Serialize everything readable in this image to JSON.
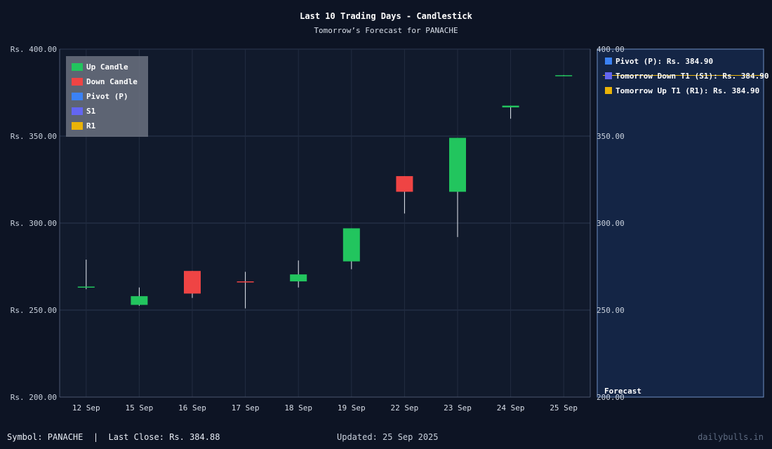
{
  "chart_data": {
    "type": "candlestick",
    "title": "Last 10 Trading Days - Candlestick",
    "subtitle": "Tomorrow’s Forecast for PANACHE",
    "categories": [
      "12 Sep",
      "15 Sep",
      "16 Sep",
      "17 Sep",
      "18 Sep",
      "19 Sep",
      "22 Sep",
      "23 Sep",
      "24 Sep",
      "25 Sep"
    ],
    "ohlc": [
      {
        "x": "12 Sep",
        "open": 263.0,
        "high": 279.0,
        "low": 262.0,
        "close": 263.5
      },
      {
        "x": "15 Sep",
        "open": 253.0,
        "high": 263.0,
        "low": 252.5,
        "close": 258.0
      },
      {
        "x": "16 Sep",
        "open": 272.5,
        "high": 272.5,
        "low": 257.0,
        "close": 259.5
      },
      {
        "x": "17 Sep",
        "open": 266.5,
        "high": 272.0,
        "low": 251.0,
        "close": 266.0
      },
      {
        "x": "18 Sep",
        "open": 266.5,
        "high": 278.5,
        "low": 263.0,
        "close": 270.5
      },
      {
        "x": "19 Sep",
        "open": 278.0,
        "high": 297.0,
        "low": 273.5,
        "close": 297.0
      },
      {
        "x": "22 Sep",
        "open": 327.0,
        "high": 327.0,
        "low": 305.5,
        "close": 318.0
      },
      {
        "x": "23 Sep",
        "open": 318.0,
        "high": 349.0,
        "low": 292.0,
        "close": 349.0
      },
      {
        "x": "24 Sep",
        "open": 366.5,
        "high": 367.5,
        "low": 360.0,
        "close": 367.5
      },
      {
        "x": "25 Sep",
        "open": 384.7,
        "high": 385.1,
        "low": 384.7,
        "close": 385.0
      }
    ],
    "ylim": [
      200,
      400
    ],
    "yticks": [
      200,
      250,
      300,
      350,
      400
    ],
    "ytick_prefix": "Rs. ",
    "grid": true,
    "legend": {
      "placement": "top-left",
      "items": [
        {
          "label": "Up Candle",
          "color": "#22c55e"
        },
        {
          "label": "Down Candle",
          "color": "#ef4444"
        },
        {
          "label": "Pivot (P)",
          "color": "#3b82f6"
        },
        {
          "label": "S1",
          "color": "#6366f1"
        },
        {
          "label": "R1",
          "color": "#eab308"
        }
      ]
    },
    "forecast": {
      "label": "Forecast",
      "pivot": 384.9,
      "s1": 384.9,
      "r1": 384.9,
      "items": [
        {
          "label": "Pivot (P): Rs. 384.90",
          "color": "#3b82f6"
        },
        {
          "label": "Tomorrow Down T1 (S1): Rs. 384.90",
          "color": "#6366f1"
        },
        {
          "label": "Tomorrow Up T1 (R1): Rs. 384.90",
          "color": "#eab308"
        }
      ]
    }
  },
  "colors": {
    "up": "#22c55e",
    "down": "#ef4444",
    "pivot": "#3b82f6",
    "s1": "#6366f1",
    "r1": "#eab308"
  },
  "footer": {
    "left": "Symbol: PANACHE  |  Last Close: Rs. 384.88",
    "center": "Updated: 25 Sep 2025",
    "right": "dailybulls.in"
  }
}
